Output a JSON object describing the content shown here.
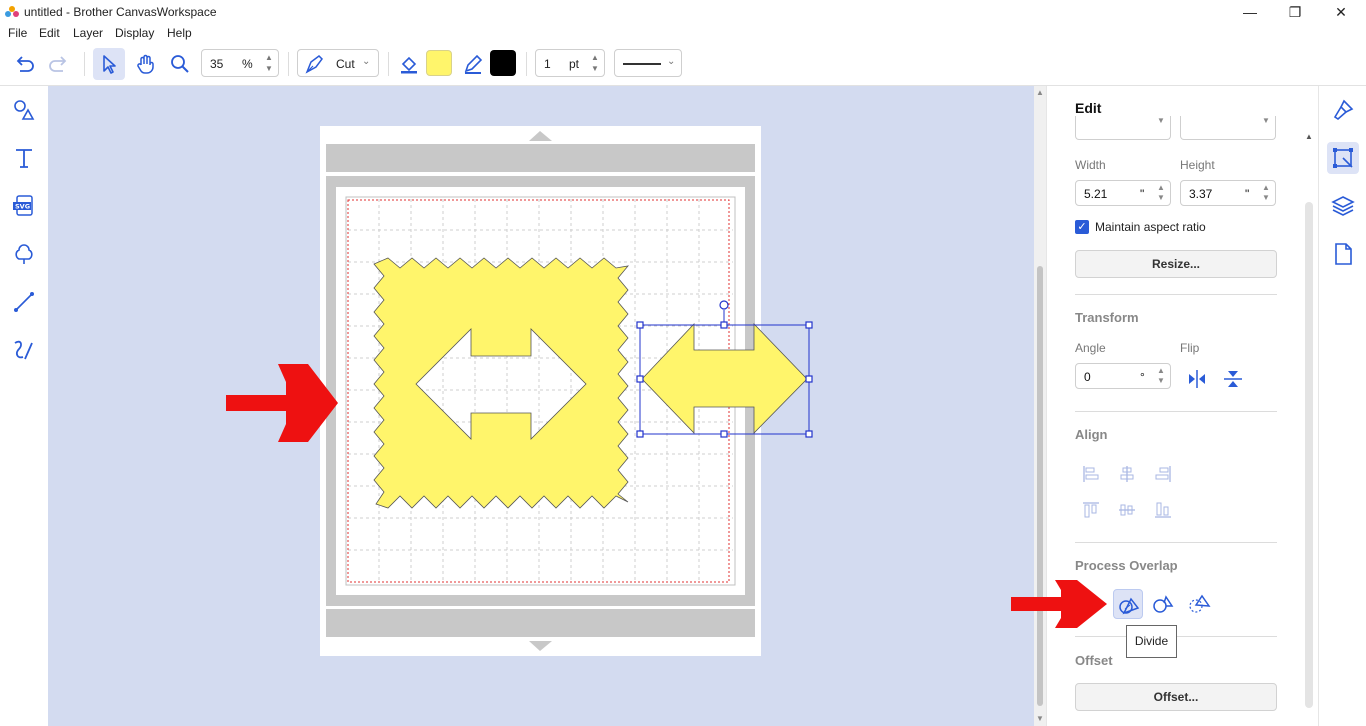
{
  "window": {
    "title": "untitled - Brother CanvasWorkspace",
    "controls": [
      "minimize",
      "restore",
      "close"
    ]
  },
  "menu": [
    "File",
    "Edit",
    "Layer",
    "Display",
    "Help"
  ],
  "toolbar": {
    "zoom_value": "35",
    "zoom_unit": "%",
    "cut_mode_label": "Cut",
    "fill_color": "#fff56b",
    "line_color": "#000000",
    "line_width_value": "1",
    "line_width_unit": "pt"
  },
  "left_tools": [
    "shapes-icon",
    "text-icon",
    "svg-import-icon",
    "cloud-shape-icon",
    "line-icon",
    "freehand-icon"
  ],
  "right_tools": [
    "paint-brush-icon",
    "edit-object-icon",
    "layers-icon",
    "page-icon"
  ],
  "canvas": {
    "background": "#d3dbf0",
    "shape_fill": "#fff56b",
    "arrow_annotation_color": "#ee1111"
  },
  "panel": {
    "title": "Edit",
    "width_label": "Width",
    "height_label": "Height",
    "width_value": "5.21",
    "height_value": "3.37",
    "inch_unit": "\"",
    "maintain_aspect_label": "Maintain aspect ratio",
    "maintain_aspect_checked": true,
    "resize_button": "Resize...",
    "transform_title": "Transform",
    "angle_label": "Angle",
    "angle_value": "0",
    "angle_unit": "°",
    "flip_label": "Flip",
    "align_title": "Align",
    "process_overlap_title": "Process Overlap",
    "offset_title": "Offset",
    "offset_button": "Offset...",
    "tooltip": "Divide"
  }
}
